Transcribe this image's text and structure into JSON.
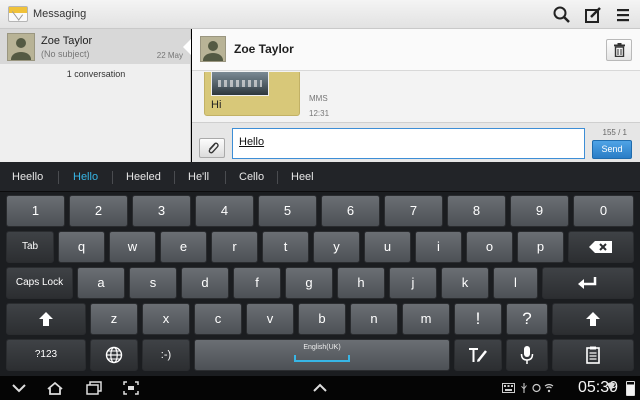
{
  "app": {
    "title": "Messaging"
  },
  "conversation_list": {
    "items": [
      {
        "name": "Zoe Taylor",
        "subject": "(No subject)",
        "date": "22 May"
      }
    ],
    "count_label": "1 conversation"
  },
  "chat": {
    "contact_name": "Zoe Taylor",
    "messages": [
      {
        "text": "Hi",
        "type": "MMS",
        "time": "12:31"
      }
    ],
    "compose": {
      "value": "Hello",
      "char_count": "155 / 1",
      "send_label": "Send"
    }
  },
  "keyboard": {
    "suggestions": [
      {
        "label": "Heello",
        "active": false
      },
      {
        "label": "Hello",
        "active": true
      },
      {
        "label": "Heeled",
        "active": false
      },
      {
        "label": "He'll",
        "active": false
      },
      {
        "label": "Cello",
        "active": false
      },
      {
        "label": "Heel",
        "active": false
      }
    ],
    "rows": [
      [
        "1",
        "2",
        "3",
        "4",
        "5",
        "6",
        "7",
        "8",
        "9",
        "0"
      ],
      [
        "q",
        "w",
        "e",
        "r",
        "t",
        "y",
        "u",
        "i",
        "o",
        "p"
      ],
      [
        "a",
        "s",
        "d",
        "f",
        "g",
        "h",
        "j",
        "k",
        "l"
      ],
      [
        "z",
        "x",
        "c",
        "v",
        "b",
        "n",
        "m",
        "!",
        "?"
      ]
    ],
    "tab_label": "Tab",
    "caps_label": "Caps Lock",
    "sym_label": "?123",
    "emoticon_label": ":-)",
    "space_label": "English(UK)",
    "icons": {
      "backspace": "backspace-icon",
      "enter": "enter-icon",
      "shift": "shift-icon",
      "globe": "globe-icon",
      "handwriting": "handwriting-icon",
      "mic": "microphone-icon",
      "clipboard": "clipboard-icon"
    }
  },
  "status_bar": {
    "time": "05:39"
  },
  "colors": {
    "accent": "#37b6e6",
    "send_button": "#2a7dc6",
    "bubble": "#d8c879",
    "keyboard_bg": "#1b1d20"
  }
}
